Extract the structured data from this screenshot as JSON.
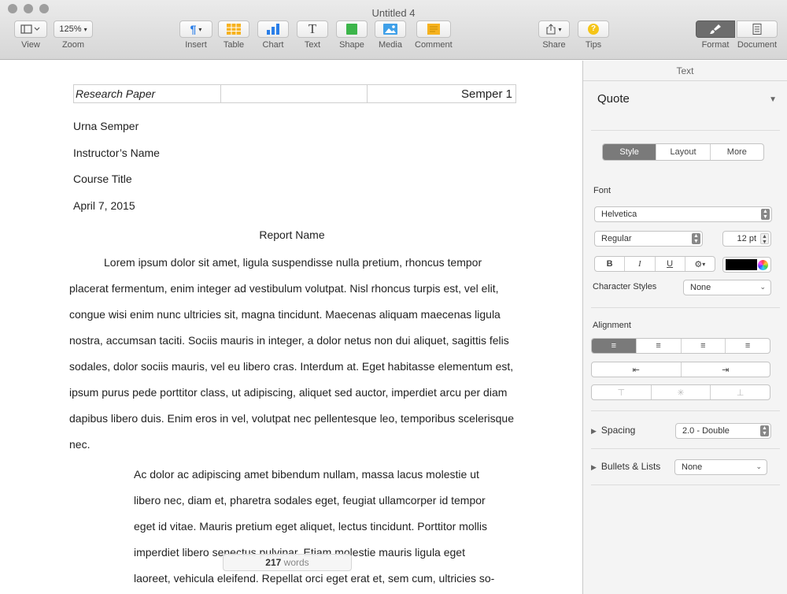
{
  "window": {
    "title": "Untitled 4"
  },
  "toolbar": {
    "view": {
      "label": "View",
      "icon": "sidebar-view-icon"
    },
    "zoom": {
      "label": "Zoom",
      "value": "125%"
    },
    "insert": {
      "label": "Insert",
      "icon": "paragraph-icon",
      "glyph": "¶"
    },
    "table": {
      "label": "Table",
      "icon": "table-icon"
    },
    "chart": {
      "label": "Chart",
      "icon": "bar-chart-icon"
    },
    "text": {
      "label": "Text",
      "icon": "text-box-icon",
      "glyph": "T"
    },
    "shape": {
      "label": "Shape",
      "icon": "shape-square-icon"
    },
    "media": {
      "label": "Media",
      "icon": "image-icon"
    },
    "comment": {
      "label": "Comment",
      "icon": "comment-note-icon"
    },
    "share": {
      "label": "Share",
      "icon": "share-icon"
    },
    "tips": {
      "label": "Tips",
      "icon": "question-icon",
      "glyph": "?"
    },
    "format": {
      "label": "Format",
      "icon": "paintbrush-icon"
    },
    "document": {
      "label": "Document",
      "icon": "document-icon"
    }
  },
  "document": {
    "header": {
      "left": "Research Paper",
      "middle": "",
      "right": "Semper 1"
    },
    "lines": [
      "Urna Semper",
      "Instructor’s Name",
      "Course Title",
      "April 7, 2015"
    ],
    "report_title": "Report Name",
    "paragraph1": "Lorem ipsum dolor sit amet, ligula suspendisse nulla pretium, rhoncus tempor placerat fermentum, enim integer ad vestibulum volutpat. Nisl rhoncus turpis est, vel elit, congue wisi enim nunc ultricies sit, magna tincidunt. Maecenas aliquam maecenas ligula nostra, accumsan taciti. Sociis mauris in integer, a dolor netus non dui aliquet, sagittis felis sodales, dolor sociis mauris, vel eu libero cras. Interdum at. Eget habitasse elementum est, ipsum purus pede porttitor class, ut adipiscing, aliquet sed auctor, imperdiet arcu per diam dapibus libero duis. Enim eros in vel, volutpat nec pellentesque leo, temporibus scelerisque nec.",
    "paragraph2": "Ac dolor ac adipiscing amet bibendum nullam, massa lacus molestie ut libero nec, diam et, pharetra sodales eget, feugiat ullamcorper id tempor eget id vitae. Mauris pretium eget aliquet, lectus tincidunt. Porttitor mollis imperdiet libero senectus pulvinar. Etiam molestie mauris ligula eget laoreet, vehicula eleifend. Repellat orci eget erat et, sem cum, ultricies so-",
    "word_count": {
      "number": "217",
      "label": "words"
    }
  },
  "inspector": {
    "header": "Text",
    "paragraph_style": "Quote",
    "tabs": [
      "Style",
      "Layout",
      "More"
    ],
    "font_label": "Font",
    "font_family": "Helvetica",
    "font_style": "Regular",
    "font_size": "12 pt",
    "bold": "B",
    "italic": "I",
    "underline": "U",
    "gear": "⚙",
    "text_color": "#000000",
    "character_styles_label": "Character Styles",
    "character_styles_value": "None",
    "alignment_label": "Alignment",
    "spacing_label": "Spacing",
    "spacing_value": "2.0 - Double",
    "bullets_label": "Bullets & Lists",
    "bullets_value": "None"
  }
}
